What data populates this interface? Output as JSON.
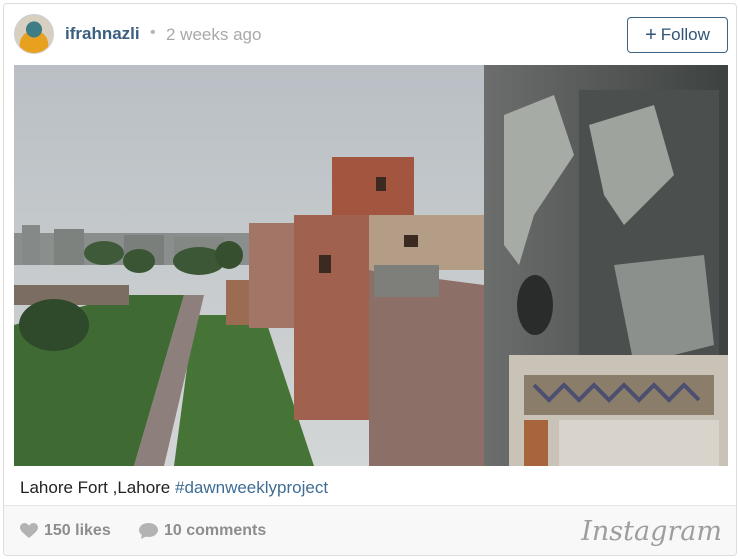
{
  "post": {
    "username": "ifrahnazli",
    "separator": "•",
    "timestamp": "2 weeks ago",
    "follow_label": "Follow",
    "follow_icon": "plus-icon"
  },
  "caption": {
    "text": "Lahore Fort ,Lahore ",
    "hashtag": "#dawnweeklyproject"
  },
  "footer": {
    "likes": "150 likes",
    "comments": "10 comments",
    "likes_icon": "heart-icon",
    "comments_icon": "speech-bubble-icon",
    "brand": "Instagram"
  },
  "colors": {
    "username": "#3c5f80",
    "hashtag": "#3e6d95",
    "follow_border": "#3c6383"
  }
}
